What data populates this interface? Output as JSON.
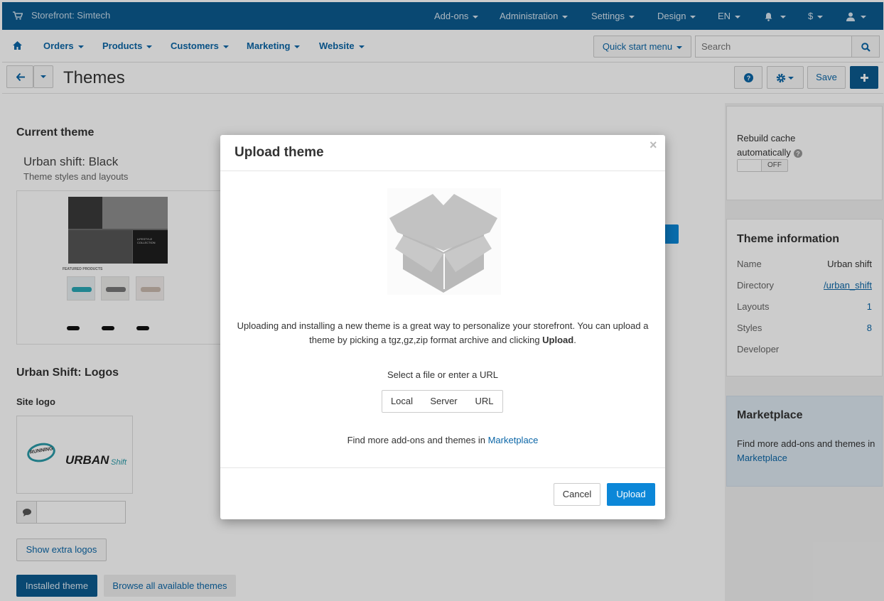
{
  "topbar": {
    "store_name": "Storefront: Simtech",
    "menu": [
      "Add-ons",
      "Administration",
      "Settings",
      "Design",
      "EN"
    ],
    "currency": "$"
  },
  "navbar": {
    "items": [
      "Orders",
      "Products",
      "Customers",
      "Marketing",
      "Website"
    ],
    "quick_start": "Quick start menu",
    "search_placeholder": "Search"
  },
  "actionbar": {
    "title": "Themes",
    "save": "Save"
  },
  "main": {
    "current_theme_heading": "Current theme",
    "theme_name": "Urban shift: Black",
    "theme_subtitle": "Theme styles and layouts",
    "preview": {
      "featured": "FEATURED PRODUCTS",
      "banner_text": "LIFESTYLE COLLECTION"
    },
    "logos_heading": "Urban Shift: Logos",
    "site_logo_label": "Site logo",
    "logo": {
      "word1": "URBAN",
      "word2": "Shift",
      "badge": "RUNNING"
    },
    "show_extra_logos": "Show extra logos",
    "installed_theme": "Installed theme",
    "browse_themes": "Browse all available themes"
  },
  "sidebar": {
    "rebuild_cache": "Rebuild cache automatically",
    "toggle_state": "OFF",
    "theme_info_heading": "Theme information",
    "info": [
      {
        "label": "Name",
        "value": "Urban shift"
      },
      {
        "label": "Directory",
        "value": "/urban_shift"
      },
      {
        "label": "Layouts",
        "value": "1"
      },
      {
        "label": "Styles",
        "value": "8"
      },
      {
        "label": "Developer",
        "value": ""
      }
    ],
    "marketplace_heading": "Marketplace",
    "marketplace_text": "Find more add-ons and themes in",
    "marketplace_link": "Marketplace"
  },
  "modal": {
    "title": "Upload theme",
    "close": "×",
    "description_part1": "Uploading and installing a new theme is a great way to personalize your storefront. You can upload a theme by picking a tgz,gz,zip format archive and clicking ",
    "description_bold": "Upload",
    "description_end": ".",
    "select_label": "Select a file or enter a URL",
    "options": [
      "Local",
      "Server",
      "URL"
    ],
    "find_more": "Find more add-ons and themes in",
    "marketplace_link": "Marketplace",
    "cancel": "Cancel",
    "upload": "Upload"
  },
  "colors": {
    "topbar": "#0c5a8f",
    "link": "#0b66a7",
    "primary_button": "#0c87d8",
    "marketplace_bg": "#dde8f1"
  }
}
